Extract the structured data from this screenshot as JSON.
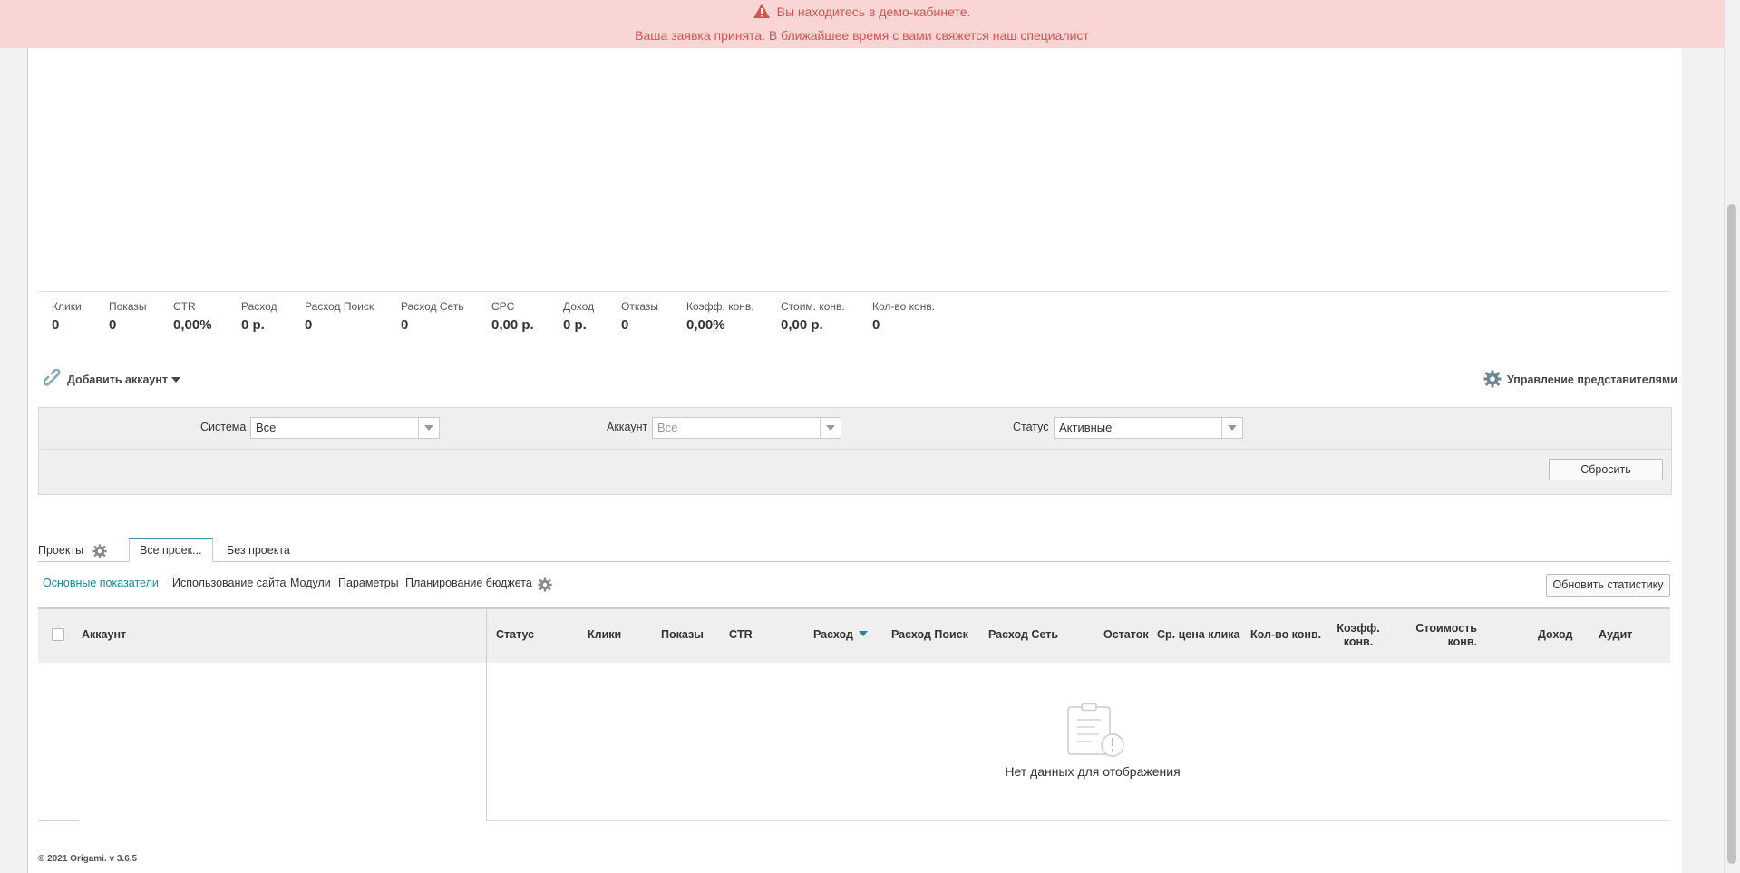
{
  "banner": {
    "line1": "Вы находитесь в демо-кабинете.",
    "line2": "Ваша заявка принята. В ближайшее время с вами свяжется наш специалист"
  },
  "stats": [
    {
      "label": "Клики",
      "value": "0"
    },
    {
      "label": "Показы",
      "value": "0"
    },
    {
      "label": "CTR",
      "value": "0,00%"
    },
    {
      "label": "Расход",
      "value": "0 р."
    },
    {
      "label": "Расход Поиск",
      "value": "0"
    },
    {
      "label": "Расход Сеть",
      "value": "0"
    },
    {
      "label": "CPC",
      "value": "0,00 р."
    },
    {
      "label": "Доход",
      "value": "0 р."
    },
    {
      "label": "Отказы",
      "value": "0"
    },
    {
      "label": "Коэфф. конв.",
      "value": "0,00%"
    },
    {
      "label": "Стоим. конв.",
      "value": "0,00 р."
    },
    {
      "label": "Кол-во конв.",
      "value": "0"
    }
  ],
  "actions": {
    "add_account": "Добавить аккаунт",
    "managers": "Управление представителями"
  },
  "filters": {
    "system_label": "Система",
    "system_value": "Все",
    "account_label": "Аккаунт",
    "account_value": "Все",
    "status_label": "Статус",
    "status_value": "Активные",
    "reset": "Сбросить"
  },
  "tabs": {
    "projects": "Проекты",
    "all_projects": "Все проек...",
    "no_project": "Без проекта"
  },
  "subnav": {
    "main": "Основные показатели",
    "site_usage": "Использование сайта",
    "modules": "Модули",
    "params": "Параметры",
    "budget": "Планирование бюджета",
    "update": "Обновить статистику"
  },
  "grid": {
    "account": "Аккаунт",
    "status": "Статус",
    "clicks": "Клики",
    "impressions": "Показы",
    "ctr": "CTR",
    "spend": "Расход",
    "spend_search": "Расход Поиск",
    "spend_network": "Расход Сеть",
    "balance": "Остаток",
    "avg_cpc": "Ср. цена клика",
    "conv_count": "Кол-во конв.",
    "conv_rate_1": "Коэфф.",
    "conv_rate_2": "конв.",
    "conv_cost_1": "Стоимость",
    "conv_cost_2": "конв.",
    "revenue": "Доход",
    "audit": "Аудит",
    "empty": "Нет данных для отображения"
  },
  "footer": "© 2021 Origami. v 3.6.5",
  "colors": {
    "banner_bg": "#f9d6d5",
    "banner_text": "#d9534f",
    "accent": "#1a8a96"
  }
}
